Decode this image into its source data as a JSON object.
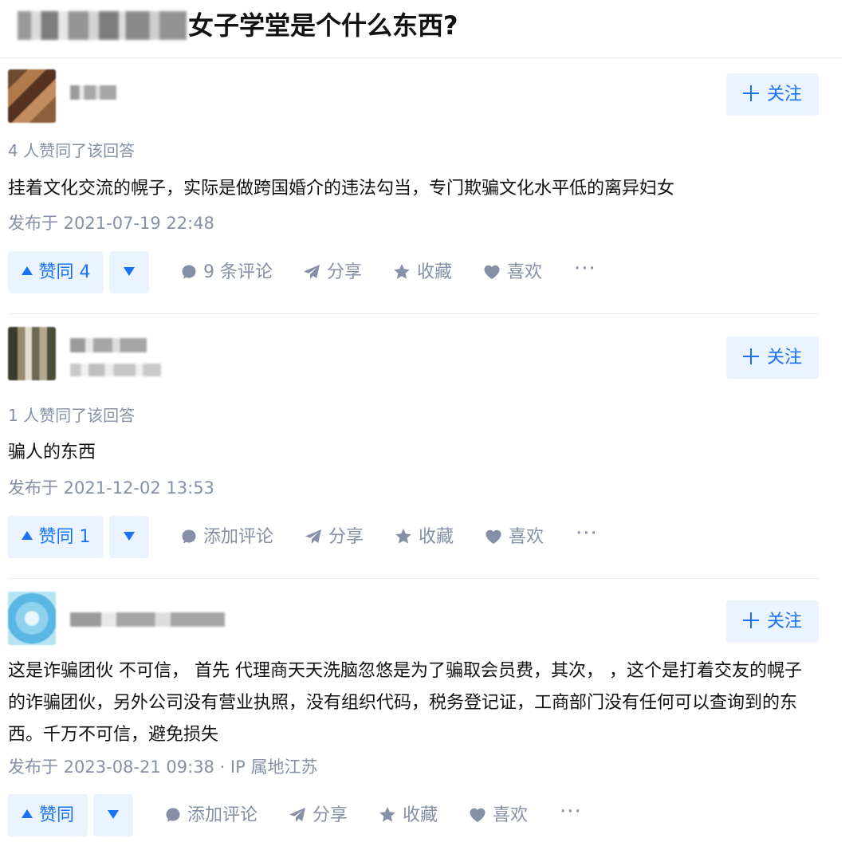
{
  "page": {
    "title": "女子学堂是个什么东西?"
  },
  "answers": [
    {
      "follow_label": "关注",
      "vote_count_text": "4 人赞同了该回答",
      "content": "挂着文化交流的幌子，实际是做跨国婚介的违法勾当，专门欺骗文化水平低的离异妇女",
      "time": "发布于 2021-07-19 22:48",
      "upvote_label": "赞同 4",
      "comment_label": "9 条评论",
      "share_label": "分享",
      "collect_label": "收藏",
      "like_label": "喜欢",
      "more_label": "···"
    },
    {
      "follow_label": "关注",
      "vote_count_text": "1 人赞同了该回答",
      "content": "骗人的东西",
      "time": "发布于 2021-12-02 13:53",
      "upvote_label": "赞同 1",
      "comment_label": "添加评论",
      "share_label": "分享",
      "collect_label": "收藏",
      "like_label": "喜欢",
      "more_label": "···"
    },
    {
      "follow_label": "关注",
      "content": "这是诈骗团伙 不可信， 首先 代理商天天洗脑忽悠是为了骗取会员费，其次， ，这个是打着交友的幌子的诈骗团伙，另外公司没有营业执照，没有组织代码，税务登记证，工商部门没有任何可以查询到的东西。千万不可信，避免损失",
      "time": "发布于 2023-08-21 09:38 · IP 属地江苏",
      "upvote_label": "赞同",
      "comment_label": "添加评论",
      "share_label": "分享",
      "collect_label": "收藏",
      "like_label": "喜欢",
      "more_label": "···"
    }
  ],
  "colors": {
    "accent": "#1772f6",
    "accent_bg": "#ebf3ff",
    "meta": "#8590a6",
    "text": "#121212"
  },
  "icons": {
    "follow": "plus-icon",
    "upvote": "triangle-up-icon",
    "downvote": "triangle-down-icon",
    "comment": "comment-bubble-icon",
    "share": "paper-plane-icon",
    "collect": "star-icon",
    "like": "heart-icon",
    "more": "ellipsis-icon"
  }
}
